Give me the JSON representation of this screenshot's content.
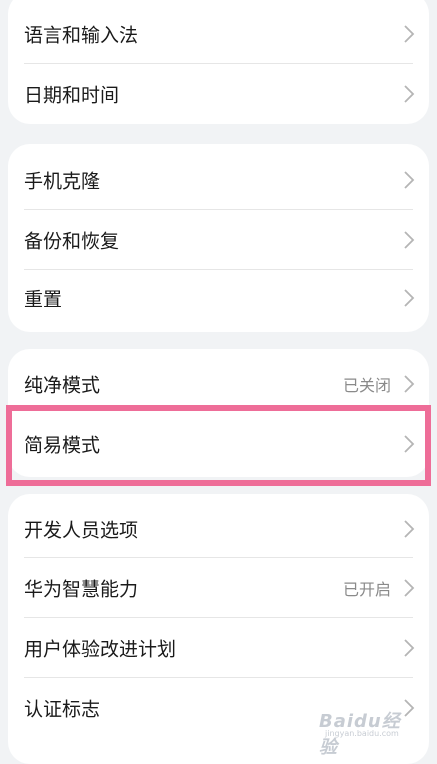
{
  "groups": [
    {
      "items": [
        {
          "label": "语言和输入法",
          "value": ""
        },
        {
          "label": "日期和时间",
          "value": ""
        }
      ]
    },
    {
      "items": [
        {
          "label": "手机克隆",
          "value": ""
        },
        {
          "label": "备份和恢复",
          "value": ""
        },
        {
          "label": "重置",
          "value": ""
        }
      ]
    },
    {
      "items": [
        {
          "label": "纯净模式",
          "value": "已关闭"
        },
        {
          "label": "简易模式",
          "value": ""
        }
      ]
    },
    {
      "items": [
        {
          "label": "开发人员选项",
          "value": ""
        },
        {
          "label": "华为智慧能力",
          "value": "已开启"
        },
        {
          "label": "用户体验改进计划",
          "value": ""
        },
        {
          "label": "认证标志",
          "value": ""
        }
      ]
    }
  ],
  "highlighted_item": "简易模式",
  "watermark": {
    "text": "Baidu经验",
    "sub": "jingyan.baidu.com"
  },
  "colors": {
    "background": "#f1f3f5",
    "card": "#ffffff",
    "highlight_border": "#ee6d98",
    "value_text": "#8a8a8a"
  },
  "icons": [
    "chevron-right-icon"
  ]
}
